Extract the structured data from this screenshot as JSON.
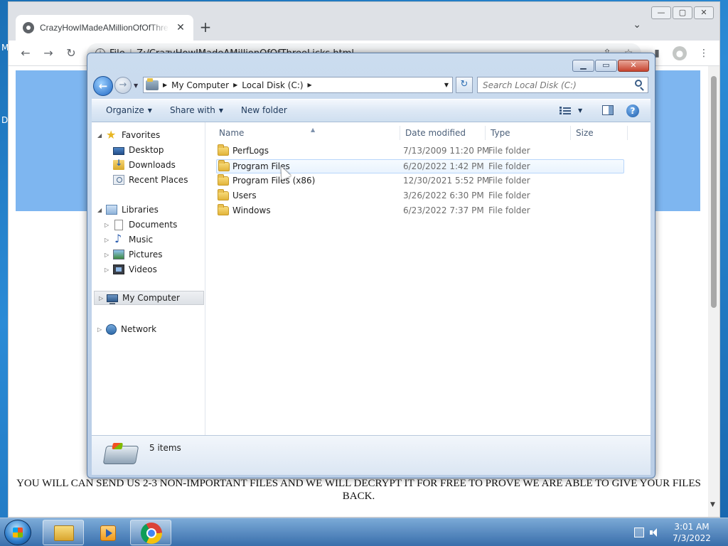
{
  "desktop": {
    "left_glyph_1": "M",
    "left_glyph_2": "D"
  },
  "browser": {
    "tab_title": "CrazyHowIMadeAMillionOfOfThreeLicks",
    "tab_close": "✕",
    "new_tab": "+",
    "tab_search": "⌄",
    "window_buttons": {
      "minimize": "—",
      "maximize": "▢",
      "close": "✕"
    },
    "back": "←",
    "forward": "→",
    "reload": "↻",
    "info": "i",
    "url_scheme": "File",
    "url_separator": "|",
    "url": "Z:/CrazyHowIMadeAMillionOfOfThreeLicks.html",
    "share": "⇪",
    "bookmark": "☆",
    "sidepanel": "▮",
    "profile": "●",
    "menu": "⋮",
    "page_text": "YOU WILL CAN SEND US 2-3 NON-IMPORTANT FILES AND WE WILL DECRYPT IT FOR FREE TO PROVE WE ARE ABLE TO GIVE YOUR FILES BACK.",
    "scroll_down": "▼"
  },
  "explorer": {
    "window_buttons": {
      "minimize": "▁",
      "maximize": "▭",
      "close": "✕"
    },
    "back_glyph": "←",
    "forward_glyph": "→",
    "nav_dropdown": "▼",
    "breadcrumb": [
      "My Computer",
      "Local Disk (C:)"
    ],
    "crumb_arrow": "▶",
    "address_dropdown": "▼",
    "refresh_glyph": "↻",
    "search_placeholder": "Search Local Disk (C:)",
    "toolbar": {
      "organize": "Organize",
      "share_with": "Share with",
      "new_folder": "New folder",
      "dropdown": "▼",
      "help": "?"
    },
    "nav_tree": {
      "expand_glyph": "◢",
      "collapse_glyph": "▷",
      "favorites": "Favorites",
      "desktop": "Desktop",
      "downloads": "Downloads",
      "recent_places": "Recent Places",
      "libraries": "Libraries",
      "documents": "Documents",
      "music": "Music",
      "pictures": "Pictures",
      "videos": "Videos",
      "my_computer": "My Computer",
      "network": "Network"
    },
    "columns": {
      "name": "Name",
      "date_modified": "Date modified",
      "type": "Type",
      "size": "Size"
    },
    "sort_glyph": "▲",
    "files": [
      {
        "name": "PerfLogs",
        "date": "7/13/2009 11:20 PM",
        "type": "File folder"
      },
      {
        "name": "Program Files",
        "date": "6/20/2022 1:42 PM",
        "type": "File folder"
      },
      {
        "name": "Program Files (x86)",
        "date": "12/30/2021 5:52 PM",
        "type": "File folder"
      },
      {
        "name": "Users",
        "date": "3/26/2022 6:30 PM",
        "type": "File folder"
      },
      {
        "name": "Windows",
        "date": "6/23/2022 7:37 PM",
        "type": "File folder"
      }
    ],
    "status": "5 items"
  },
  "taskbar": {
    "time": "3:01 AM",
    "date": "7/3/2022"
  }
}
